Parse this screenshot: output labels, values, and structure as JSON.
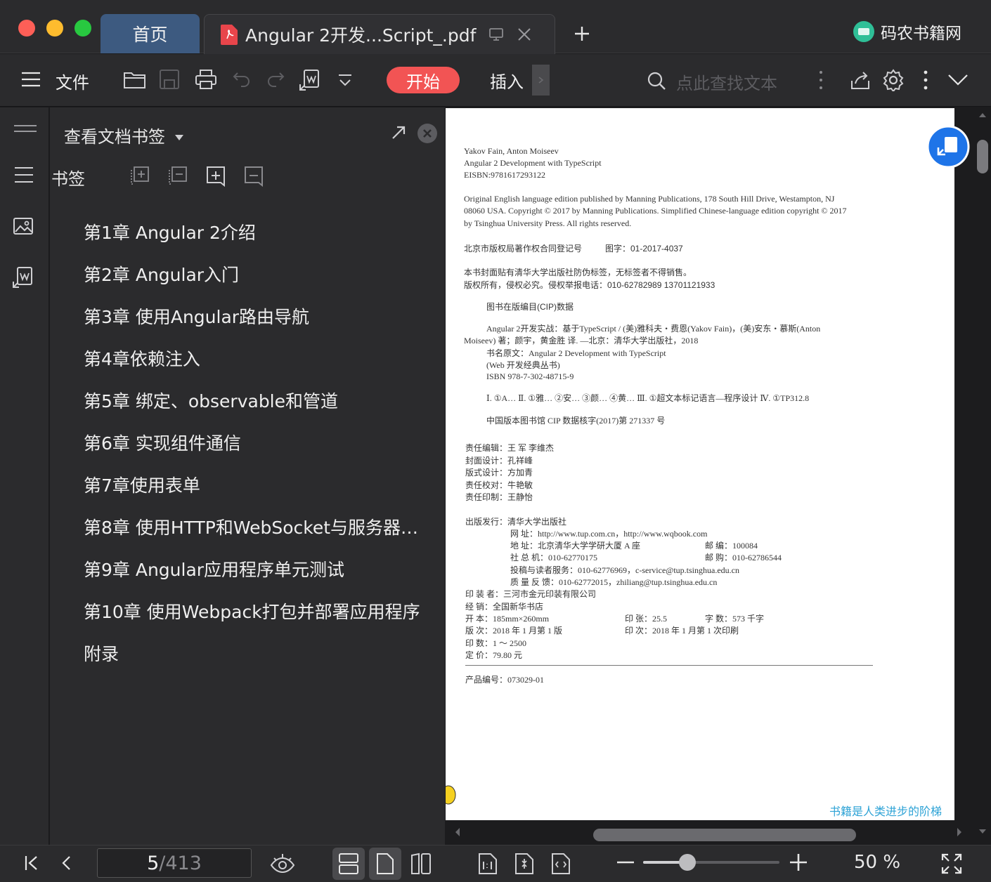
{
  "titlebar": {
    "tab_home": "首页",
    "tab_doc": "Angular 2开发...Script_.pdf",
    "brand": "码农书籍网"
  },
  "toolbar": {
    "file_label": "文件",
    "start_label": "开始",
    "insert_label": "插入",
    "search_placeholder": "点此查找文本"
  },
  "panel": {
    "title": "查看文档书签",
    "bookmarks_label": "书签",
    "items": [
      "第1章 Angular 2介绍",
      "第2章 Angular入门",
      "第3章 使用Angular路由导航",
      "第4章依赖注入",
      "第5章 绑定、observable和管道",
      "第6章 实现组件通信",
      "第7章使用表单",
      "第8章 使用HTTP和WebSocket与服务器…",
      "第9章 Angular应用程序单元测试",
      "第10章 使用Webpack打包并部署应用程序",
      "附录"
    ]
  },
  "page": {
    "l1": "Yakov Fain, Anton Moiseev",
    "l2": "Angular 2 Development with TypeScript",
    "l3": "EISBN:9781617293122",
    "p1a": "Original English language edition published by Manning Publications, 178 South Hill Drive, Westampton, NJ",
    "p1b": "08060 USA. Copyright © 2017 by Manning Publications. Simplified Chinese-language edition copyright © 2017",
    "p1c": "by Tsinghua University Press.  All rights reserved.",
    "reg_label": "北京市版权局著作权合同登记号",
    "reg_num": "图字：01-2017-4037",
    "notice1": "本书封面贴有清华大学出版社防伪标签，无标签者不得销售。",
    "notice2": "版权所有，侵权必究。侵权举报电话：010-62782989  13701121933",
    "cip_title": "图书在版编目(CIP)数据",
    "cip1": "Angular 2开发实战：基于TypeScript / (美)雅科夫・费恩(Yakov Fain)，(美)安东・慕斯(Anton",
    "cip2": "Moiseev)  著；颜宇，黄金胜  译. —北京：清华大学出版社，2018",
    "cip3": "书名原文：Angular 2 Development with TypeScript",
    "cip4": "(Web 开发经典丛书)",
    "cip5": "ISBN 978-7-302-48715-9",
    "cip6": "Ⅰ. ①A…   Ⅱ. ①雅… ②安… ③颜… ④黄…   Ⅲ. ①超文本标记语言—程序设计   Ⅳ. ①TP312.8",
    "cip7": "中国版本图书馆 CIP 数据核字(2017)第 271337 号",
    "e1": "责任编辑：王    军    李维杰",
    "e2": "封面设计：孔祥峰",
    "e3": "版式设计：方加青",
    "e4": "责任校对：牛艳敏",
    "e5": "责任印制：王静怡",
    "pub1": "出版发行：清华大学出版社",
    "pub2": "网        址：http://www.tup.com.cn，http://www.wqbook.com",
    "pub3": "地        址：北京清华大学学研大厦 A 座",
    "pub3r": "邮        编：100084",
    "pub4": "社  总  机：010-62770175",
    "pub4r": "邮        购：010-62786544",
    "pub5": "投稿与读者服务：010-62776969，c-service@tup.tsinghua.edu.cn",
    "pub6": "质    量    反    馈：010-62772015，zhiliang@tup.tsinghua.edu.cn",
    "pr1": "印  装  者：三河市金元印装有限公司",
    "pr2": "经        销：全国新华书店",
    "pr3": "开        本：185mm×260mm",
    "pr3b": "印        张：25.5",
    "pr3c": "字        数：573 千字",
    "pr4": "版        次：2018 年 1 月第 1 版",
    "pr4b": "印        次：2018 年 1 月第 1 次印刷",
    "pr5": "印        数：1 ～ 2500",
    "pr6": "定        价：79.80 元",
    "product_no": "产品编号：073029-01",
    "slogan": "书籍是人类进步的阶梯"
  },
  "statusbar": {
    "page_current": "5",
    "page_total": "/413",
    "zoom": "50 %",
    "zoom_fraction": 0.3
  },
  "colors": {
    "accent_red": "#f25454",
    "home_tab": "#3d5a80",
    "slogan": "#2ea3d6"
  }
}
